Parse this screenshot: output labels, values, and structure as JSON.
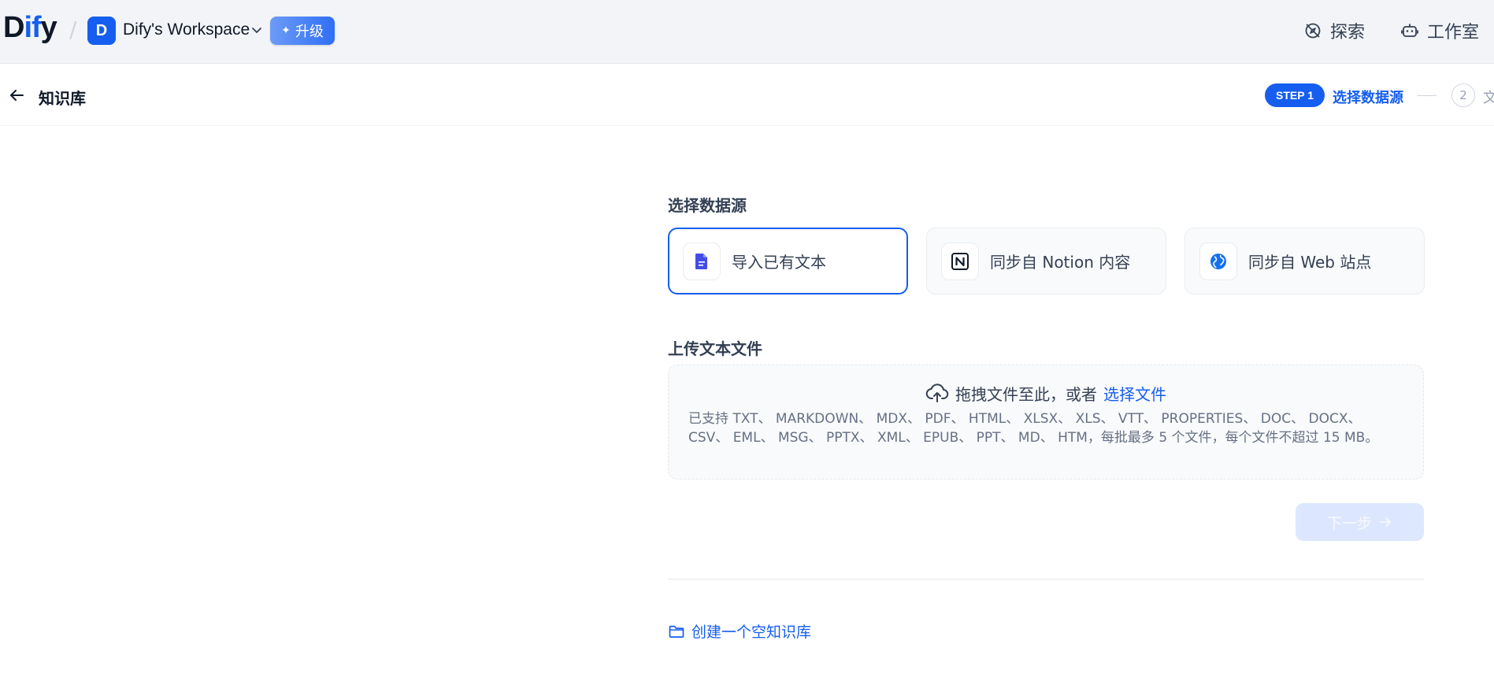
{
  "header": {
    "logo_text_pre": "D",
    "logo_text_mid": "if",
    "logo_text_post": "y",
    "separator": "/",
    "workspace_initial": "D",
    "workspace_name": "Dify's Workspace",
    "upgrade_label": "升级",
    "nav": {
      "explore_label": "探索",
      "studio_label": "工作室"
    }
  },
  "subheader": {
    "title": "知识库",
    "step1_badge": "STEP 1",
    "step1_label": "选择数据源",
    "step2_number": "2",
    "step2_label": "文"
  },
  "datasource": {
    "section_title": "选择数据源",
    "options": [
      {
        "label": "导入已有文本",
        "icon": "file-text-icon",
        "selected": true
      },
      {
        "label": "同步自 Notion 内容",
        "icon": "notion-icon",
        "selected": false
      },
      {
        "label": "同步自 Web 站点",
        "icon": "globe-icon",
        "selected": false
      }
    ]
  },
  "upload": {
    "section_title": "上传文本文件",
    "drag_text": "拖拽文件至此，或者",
    "select_link": "选择文件",
    "tip": "已支持 TXT、 MARKDOWN、 MDX、 PDF、 HTML、 XLSX、 XLS、 VTT、 PROPERTIES、 DOC、 DOCX、 CSV、 EML、 MSG、 PPTX、 XML、 EPUB、 PPT、 MD、 HTM，每批最多 5 个文件，每个文件不超过 15 MB。"
  },
  "actions": {
    "next_label": "下一步",
    "create_empty_label": "创建一个空知识库"
  },
  "colors": {
    "primary": "#155eef",
    "nav_bg": "#f2f4f7",
    "next_disabled_bg": "#d1e0ff"
  }
}
